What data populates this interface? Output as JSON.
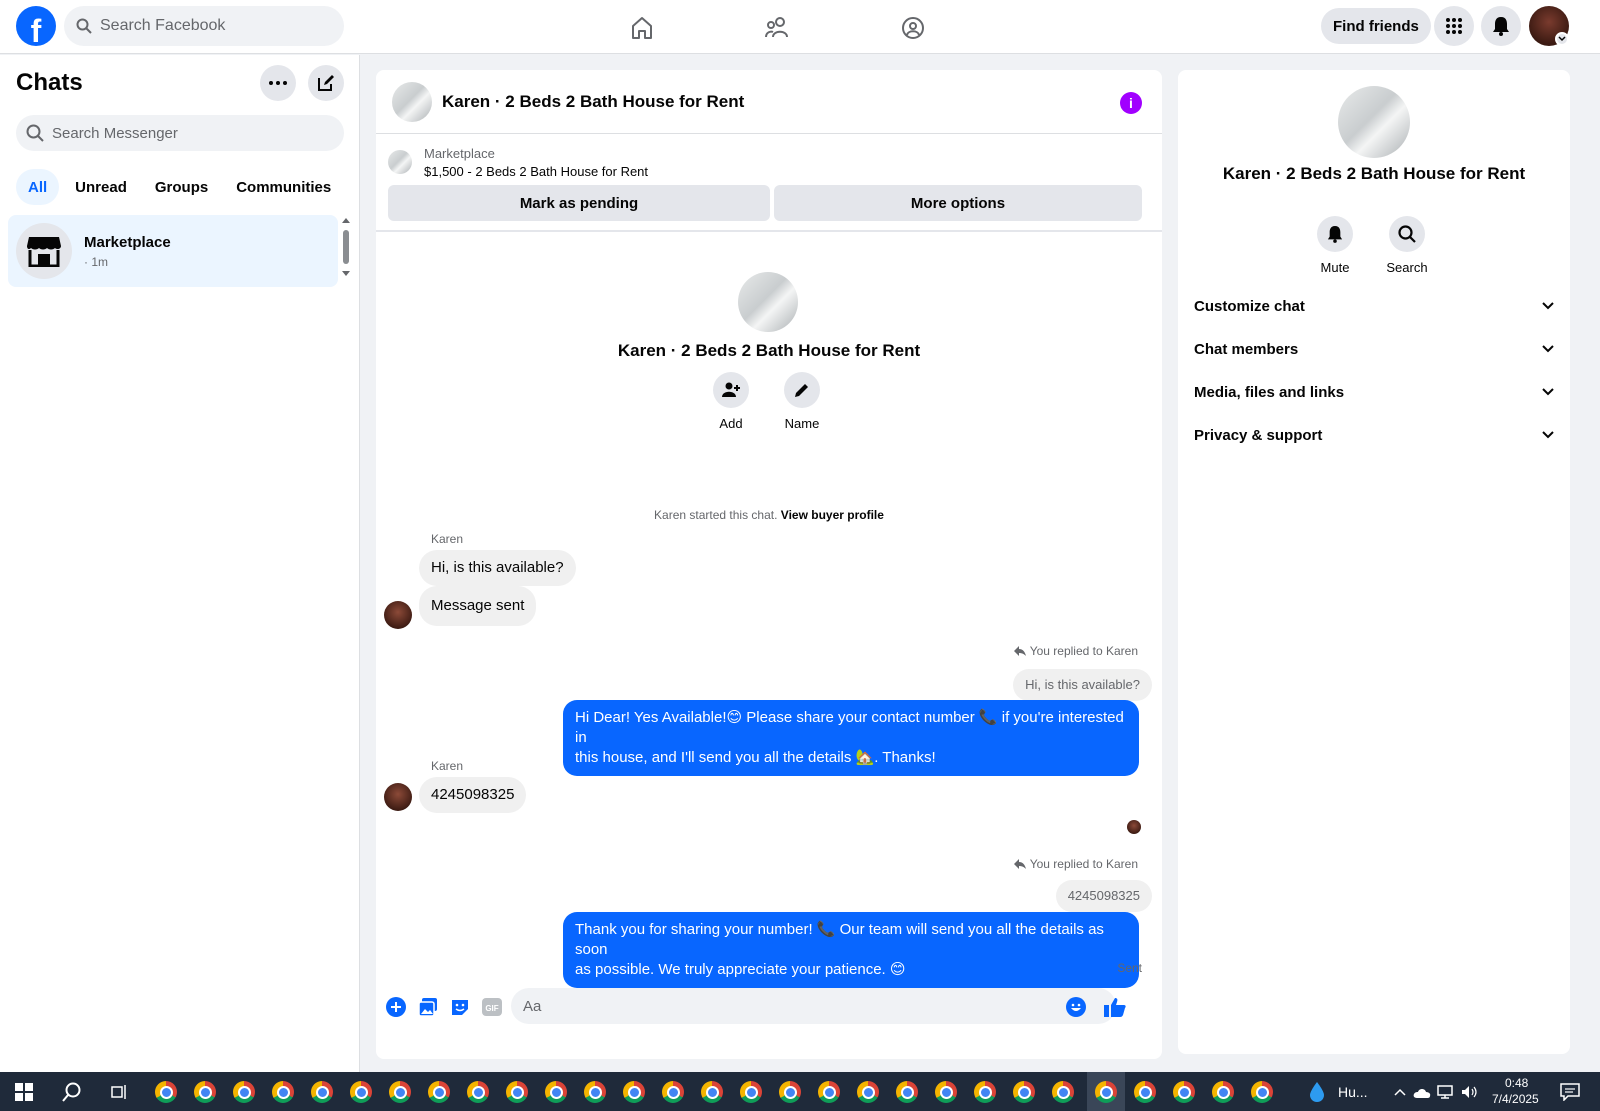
{
  "topbar": {
    "search_placeholder": "Search Facebook",
    "find_friends": "Find friends"
  },
  "sidebar": {
    "title": "Chats",
    "search_placeholder": "Search Messenger",
    "tabs": [
      "All",
      "Unread",
      "Groups",
      "Communities"
    ],
    "chats": [
      {
        "name": "Marketplace",
        "time": "· 1m"
      }
    ]
  },
  "chat": {
    "title": "Karen · 2 Beds 2 Bath House for Rent",
    "listing_source": "Marketplace",
    "listing_title": "$1,500 - 2 Beds 2 Bath House for Rent",
    "mark_pending": "Mark as pending",
    "more_options": "More options",
    "hero_name": "Karen · 2 Beds 2 Bath House for Rent",
    "add_label": "Add",
    "name_label": "Name",
    "started_text": "Karen started this chat.",
    "view_buyer": "View buyer profile",
    "sender": "Karen",
    "msg1": "Hi, is this available?",
    "msg2": "Message sent",
    "replied_label": "You replied to Karen",
    "quote1": "Hi, is this available?",
    "out1_line1": "Hi Dear! Yes Available!😊 Please share your contact number 📞 if you're interested in",
    "out1_line2": "this house, and I'll send you all the details 🏡. Thanks!",
    "msg3": "4245098325",
    "quote2": "4245098325",
    "out2_line1": "Thank you for sharing your number! 📞 Our team will send you all the details as soon",
    "out2_line2": "as possible. We truly appreciate your patience. 😊",
    "sent_label": "Sent",
    "composer_placeholder": "Aa"
  },
  "details": {
    "name": "Karen · 2 Beds 2 Bath House for Rent",
    "mute": "Mute",
    "search": "Search",
    "sections": [
      "Customize chat",
      "Chat members",
      "Media, files and links",
      "Privacy & support"
    ]
  },
  "taskbar": {
    "weather": "Hu...",
    "time": "0:48",
    "date": "7/4/2025"
  },
  "colors": {
    "brand": "#0866ff",
    "info": "#a100ff"
  }
}
